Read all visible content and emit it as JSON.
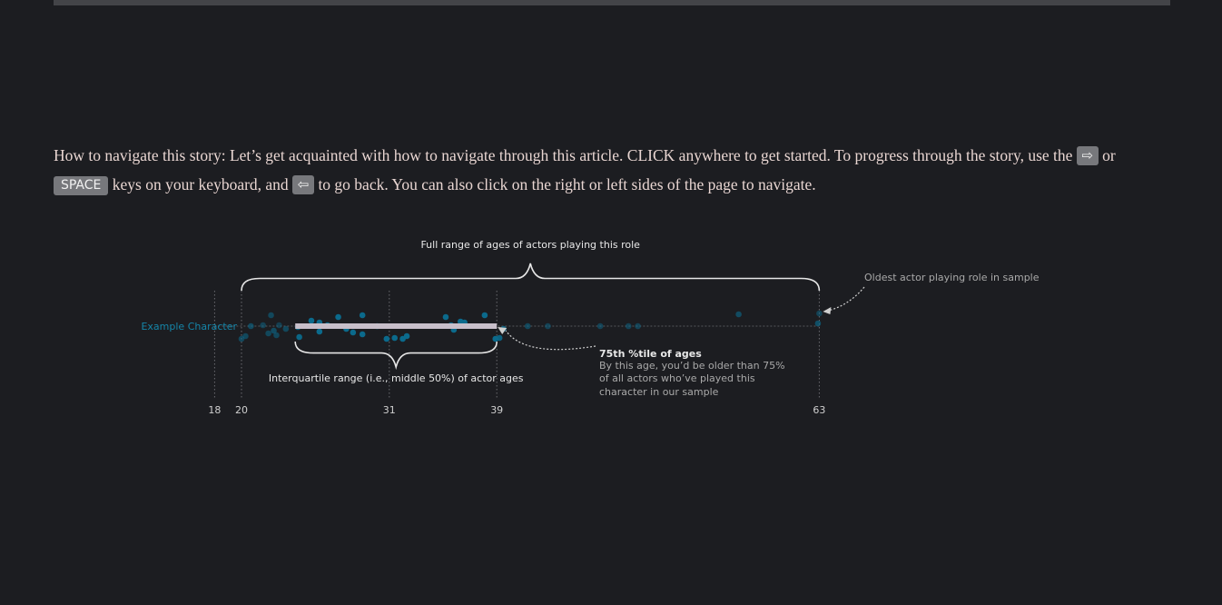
{
  "intro": {
    "label": "How to navigate this story:",
    "part1": "Let’s get acquainted with how to navigate through this article. CLICK anywhere to get started. To progress through the story, use the",
    "key_next": "⇨",
    "or": "or",
    "key_space": "SPACE",
    "part2": "keys on your keyboard, and",
    "key_back": "⇦",
    "part3": "to go back. You can also click on the right or left sides of the page to navigate."
  },
  "colors": {
    "background": "#1c1d21",
    "dot": "#0b6a8c",
    "label": "#1585a8",
    "iqr_bar": "#c8bfca",
    "annotation": "#e8e8e8",
    "muted": "#a9a9a9"
  },
  "chart_data": {
    "type": "scatter",
    "row_label": "Example Character",
    "x_ticks": [
      18,
      20,
      31,
      39,
      63
    ],
    "x_tick_labels": [
      "18",
      "20",
      "31",
      "39",
      "63"
    ],
    "min_age": 20,
    "q3_age": 39,
    "max_age": 63,
    "iqr_bar": [
      24,
      39
    ],
    "points": [
      {
        "age": 20.0,
        "offset": 14,
        "alpha": 0.55
      },
      {
        "age": 20.3,
        "offset": 11,
        "alpha": 0.55
      },
      {
        "age": 20.7,
        "offset": 0,
        "alpha": 0.6
      },
      {
        "age": 21.6,
        "offset": -1,
        "alpha": 0.5
      },
      {
        "age": 22.0,
        "offset": 8,
        "alpha": 0.55
      },
      {
        "age": 22.2,
        "offset": -12,
        "alpha": 0.55
      },
      {
        "age": 22.4,
        "offset": 5,
        "alpha": 0.6
      },
      {
        "age": 22.6,
        "offset": 10,
        "alpha": 0.55
      },
      {
        "age": 22.8,
        "offset": -1,
        "alpha": 0.45
      },
      {
        "age": 23.3,
        "offset": 3,
        "alpha": 0.55
      },
      {
        "age": 24.2,
        "offset": 1,
        "alpha": 0.9
      },
      {
        "age": 24.3,
        "offset": 12,
        "alpha": 0.95
      },
      {
        "age": 25.2,
        "offset": -6,
        "alpha": 1
      },
      {
        "age": 25.8,
        "offset": 6,
        "alpha": 1
      },
      {
        "age": 25.8,
        "offset": -4,
        "alpha": 1
      },
      {
        "age": 26.4,
        "offset": -1,
        "alpha": 1
      },
      {
        "age": 27.2,
        "offset": -10,
        "alpha": 1
      },
      {
        "age": 27.8,
        "offset": 3,
        "alpha": 1
      },
      {
        "age": 28.3,
        "offset": 7,
        "alpha": 1
      },
      {
        "age": 29.0,
        "offset": 9,
        "alpha": 1
      },
      {
        "age": 29.0,
        "offset": -12,
        "alpha": 1
      },
      {
        "age": 30.1,
        "offset": 0,
        "alpha": 1
      },
      {
        "age": 30.8,
        "offset": 14,
        "alpha": 1
      },
      {
        "age": 31.4,
        "offset": 13,
        "alpha": 1
      },
      {
        "age": 32.0,
        "offset": 14,
        "alpha": 1
      },
      {
        "age": 32.3,
        "offset": 11,
        "alpha": 1
      },
      {
        "age": 35.2,
        "offset": -10,
        "alpha": 1
      },
      {
        "age": 35.6,
        "offset": -1,
        "alpha": 1
      },
      {
        "age": 35.8,
        "offset": 4,
        "alpha": 1
      },
      {
        "age": 36.3,
        "offset": -5,
        "alpha": 1
      },
      {
        "age": 36.6,
        "offset": -4,
        "alpha": 1
      },
      {
        "age": 38.1,
        "offset": -12,
        "alpha": 1
      },
      {
        "age": 38.9,
        "offset": 14,
        "alpha": 1
      },
      {
        "age": 39.2,
        "offset": 13,
        "alpha": 0.9
      },
      {
        "age": 39.5,
        "offset": 3,
        "alpha": 0.85
      },
      {
        "age": 41.3,
        "offset": 0,
        "alpha": 0.55
      },
      {
        "age": 42.8,
        "offset": 0,
        "alpha": 0.5
      },
      {
        "age": 46.7,
        "offset": 0,
        "alpha": 0.5
      },
      {
        "age": 48.8,
        "offset": 0,
        "alpha": 0.5
      },
      {
        "age": 49.5,
        "offset": 0,
        "alpha": 0.5
      },
      {
        "age": 57.0,
        "offset": -13,
        "alpha": 0.6
      },
      {
        "age": 62.9,
        "offset": -3,
        "alpha": 0.65
      },
      {
        "age": 63.0,
        "offset": -14,
        "alpha": 0.5
      }
    ],
    "annotations": {
      "full_range": "Full range of ages of actors playing this role",
      "oldest": "Oldest actor playing role in sample",
      "iqr": "Interquartile range (i.e., middle 50%) of actor ages",
      "q3_title": "75th %tile of ages",
      "q3_line1": "By this age, you’d be older than 75%",
      "q3_line2": "of all actors who’ve played this",
      "q3_line3": "character in our sample"
    }
  }
}
